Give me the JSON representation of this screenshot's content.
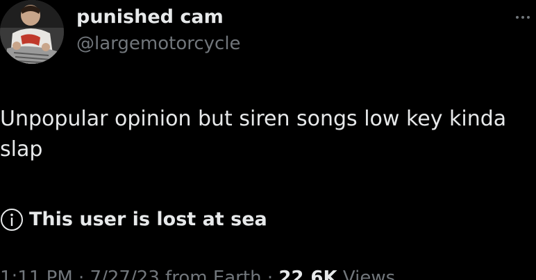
{
  "author": {
    "display_name": "punished cam",
    "handle": "@largemotorcycle",
    "avatar_icon": "profile-photo"
  },
  "tweet": {
    "text": "Unpopular opinion but siren songs low key kinda\nslap",
    "notice_icon": "info-icon",
    "notice_text": "This user is lost at sea",
    "timestamp": "1:11 PM · 7/27/23 from Earth",
    "views_count": "22.6K",
    "views_label": "Views"
  },
  "colors": {
    "background": "#000000",
    "primary_text": "#e7e9ea",
    "secondary_text": "#71767b"
  }
}
